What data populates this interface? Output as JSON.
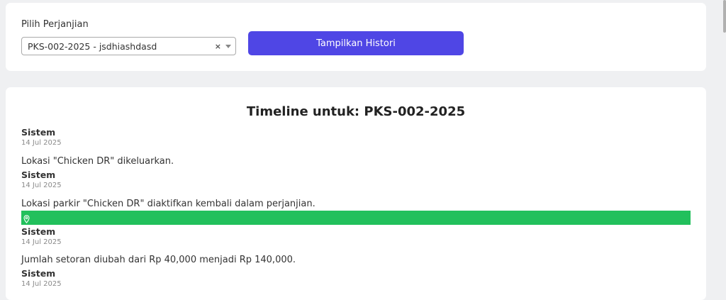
{
  "filter": {
    "label": "Pilih Perjanjian",
    "selected_value": "PKS-002-2025 - jsdhiashdasd",
    "clear_symbol": "×",
    "button_label": "Tampilkan Histori"
  },
  "timeline": {
    "title": "Timeline untuk: PKS-002-2025",
    "entries": [
      {
        "actor": "Sistem",
        "date": "14 Jul 2025",
        "message": "Lokasi \"Chicken DR\" dikeluarkan."
      },
      {
        "actor": "Sistem",
        "date": "14 Jul 2025",
        "message": "Lokasi parkir \"Chicken DR\" diaktifkan kembali dalam perjanjian."
      },
      {
        "actor": "Sistem",
        "date": "14 Jul 2025",
        "message": "Jumlah setoran diubah dari Rp 40,000 menjadi Rp 140,000."
      },
      {
        "actor": "Sistem",
        "date": "14 Jul 2025",
        "message": ""
      }
    ],
    "highlight_color": "#22c05c",
    "highlight_icon": "map-pin-icon"
  },
  "colors": {
    "primary": "#4f46e5",
    "background": "#eff0f2"
  }
}
